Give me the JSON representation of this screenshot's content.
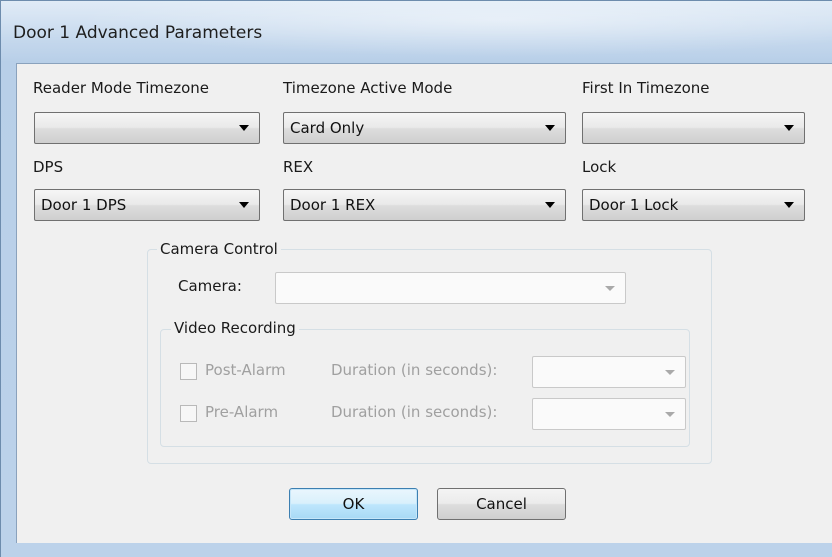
{
  "window": {
    "title": "Door 1 Advanced Parameters"
  },
  "fields": {
    "reader_mode_timezone": {
      "label": "Reader Mode Timezone",
      "value": ""
    },
    "timezone_active_mode": {
      "label": "Timezone Active Mode",
      "value": "Card Only"
    },
    "first_in_timezone": {
      "label": "First In Timezone",
      "value": ""
    },
    "dps": {
      "label": "DPS",
      "value": "Door 1 DPS"
    },
    "rex": {
      "label": "REX",
      "value": "Door 1 REX"
    },
    "lock": {
      "label": "Lock",
      "value": "Door 1 Lock"
    }
  },
  "camera_control": {
    "title": "Camera Control",
    "camera_label": "Camera:",
    "camera_value": "",
    "video_recording": {
      "title": "Video Recording",
      "post_alarm": {
        "label": "Post-Alarm",
        "checked": false,
        "duration_label": "Duration (in seconds):",
        "duration_value": ""
      },
      "pre_alarm": {
        "label": "Pre-Alarm",
        "checked": false,
        "duration_label": "Duration (in seconds):",
        "duration_value": ""
      }
    }
  },
  "buttons": {
    "ok": "OK",
    "cancel": "Cancel"
  }
}
